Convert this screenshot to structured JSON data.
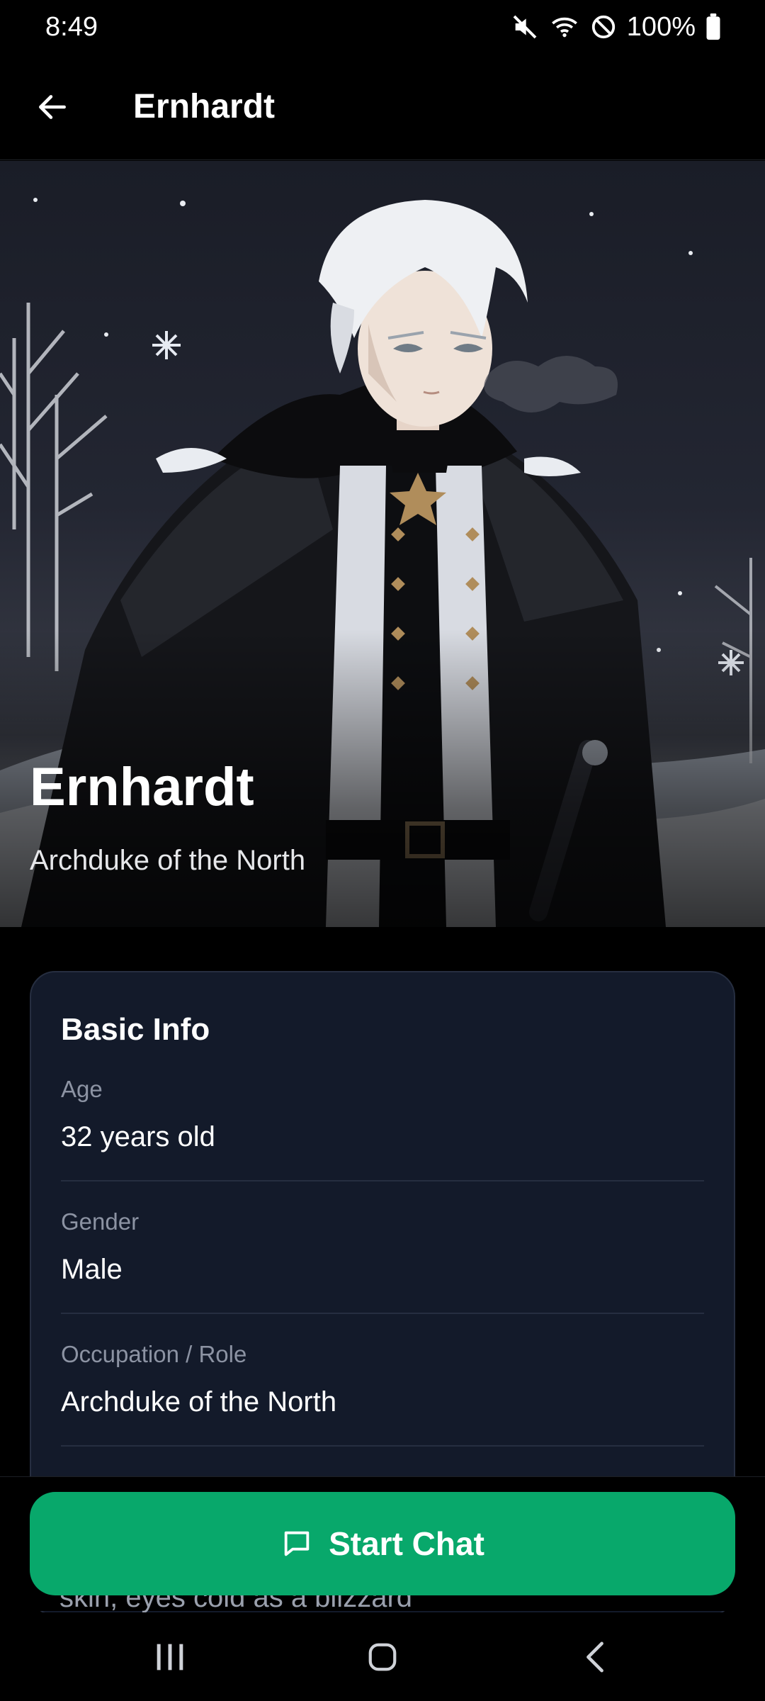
{
  "status_bar": {
    "time": "8:49",
    "battery_text": "100%",
    "icons": [
      "mute-icon",
      "wifi-icon",
      "do-not-disturb-icon",
      "battery-icon"
    ]
  },
  "app_bar": {
    "back_icon": "arrow-left-icon",
    "title": "Ernhardt"
  },
  "hero": {
    "name": "Ernhardt",
    "subtitle": "Archduke of the North"
  },
  "basic_info": {
    "title": "Basic Info",
    "fields": [
      {
        "label": "Age",
        "value": "32 years old"
      },
      {
        "label": "Gender",
        "value": "Male"
      },
      {
        "label": "Occupation / Role",
        "value": "Archduke of the North"
      }
    ],
    "peek_text": "skin, eyes cold as a blizzard"
  },
  "actions": {
    "start_chat_label": "Start Chat",
    "start_chat_icon": "chat-bubble-icon"
  },
  "colors": {
    "accent": "#08a86b",
    "card_bg": "#131a2a",
    "muted_text": "#8c93a3"
  }
}
